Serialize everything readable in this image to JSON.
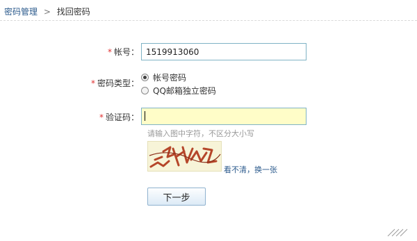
{
  "breadcrumb": {
    "parent": "密码管理",
    "separator": ">",
    "current": "找回密码"
  },
  "form": {
    "account": {
      "required_mark": "*",
      "label": "帐号：",
      "value": "1519913060"
    },
    "password_type": {
      "required_mark": "*",
      "label": "密码类型：",
      "options": [
        {
          "label": "帐号密码",
          "selected": true
        },
        {
          "label": "QQ邮箱独立密码",
          "selected": false
        }
      ]
    },
    "captcha": {
      "required_mark": "*",
      "label": "验证码：",
      "value": "",
      "hint": "请输入图中字符，不区分大小写",
      "refresh_link": "看不清，换一张"
    },
    "next_button": "下一步"
  },
  "colors": {
    "link": "#2b5a8c",
    "required": "#e03030",
    "input_border": "#7fb3c5",
    "captcha_input_bg": "#fffdc8",
    "captcha_ink": "#b5462a"
  }
}
